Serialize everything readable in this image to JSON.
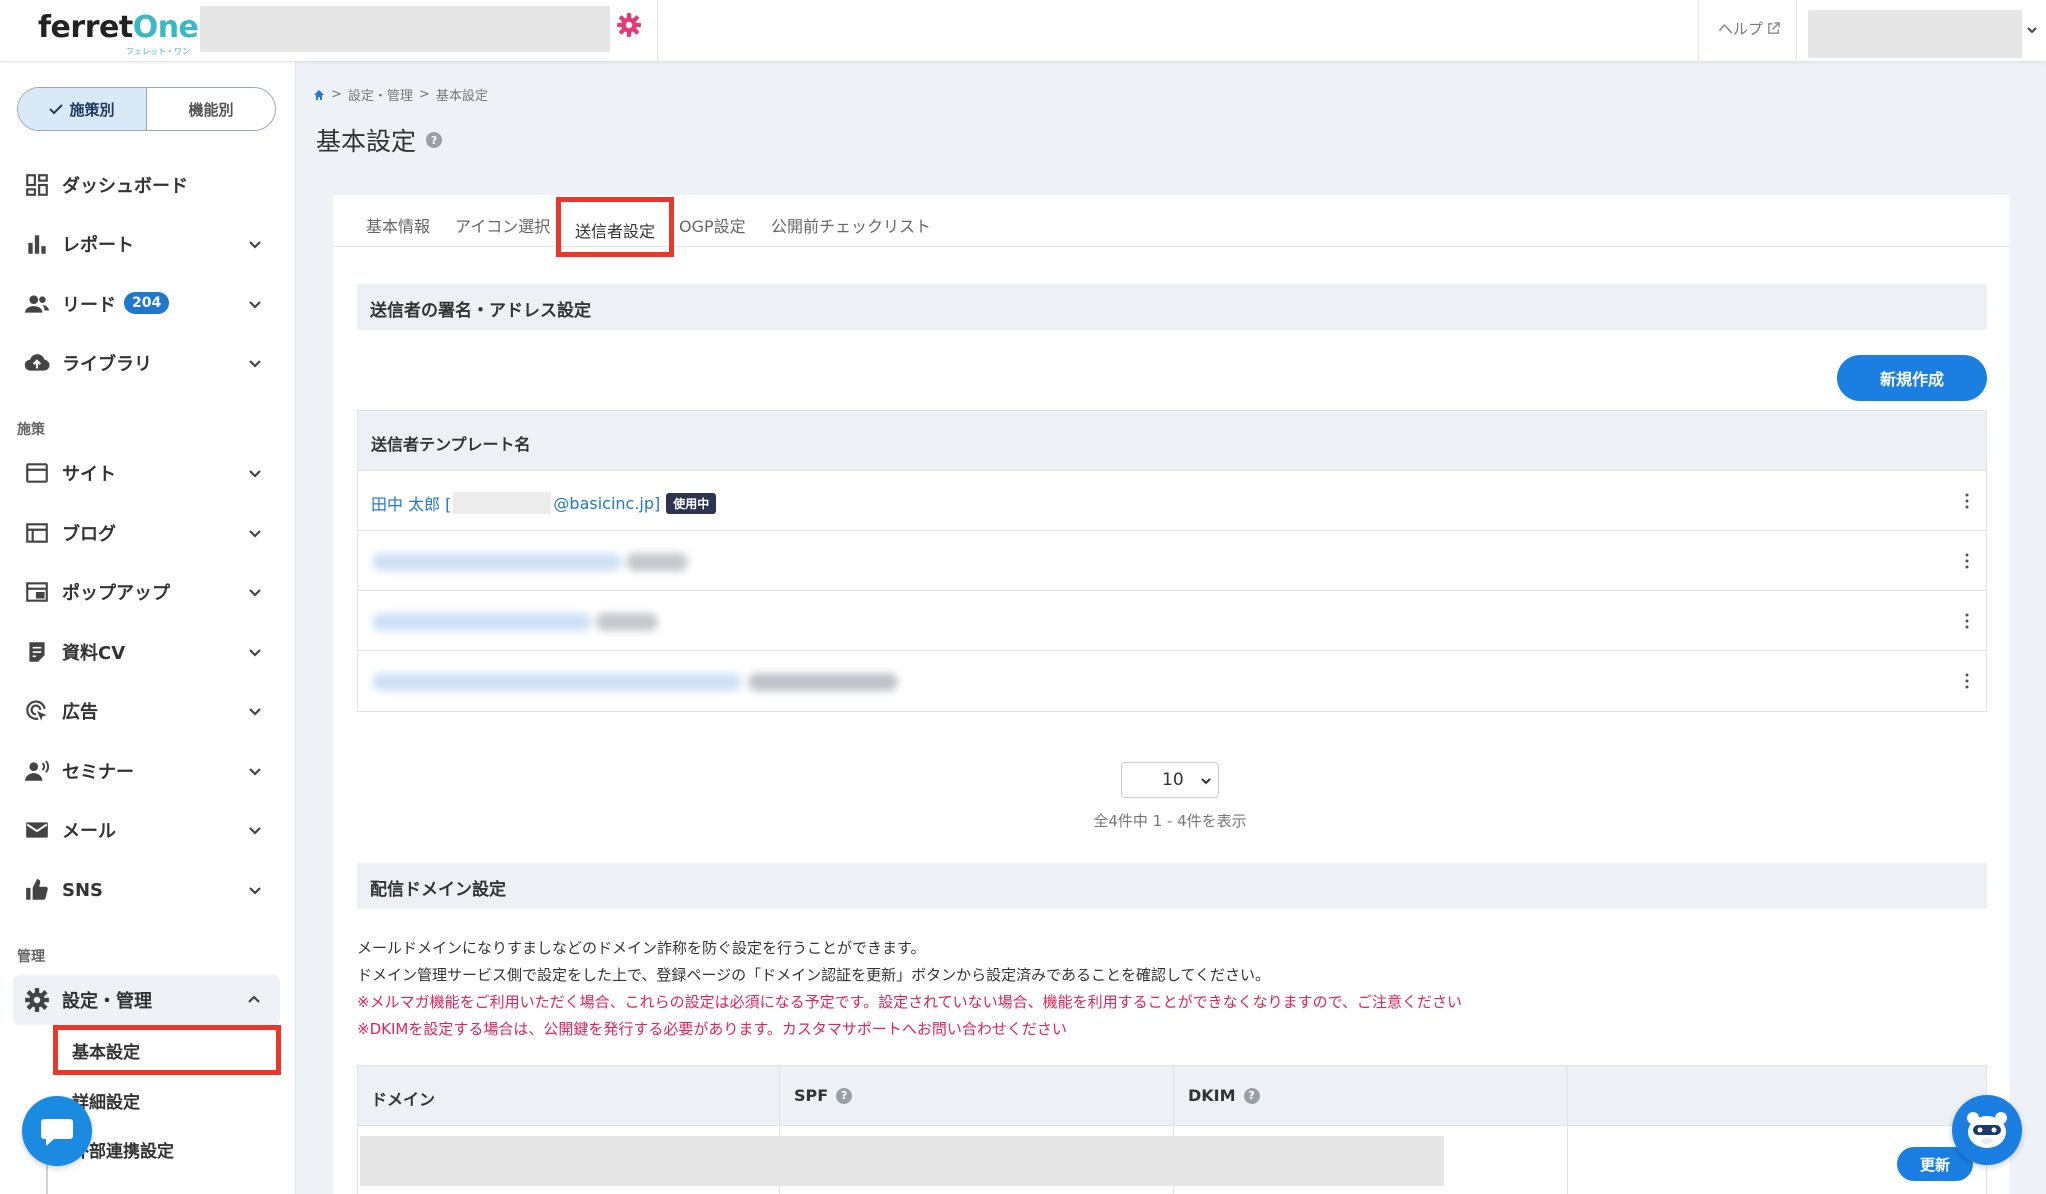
{
  "header": {
    "logo_text_main": "ferret",
    "logo_text_accent": "One",
    "logo_subtext": "フェレット・ワン",
    "help_label": "ヘルプ",
    "site_settings_icon": "gear-icon",
    "help_icon": "external-link-icon"
  },
  "sidebar": {
    "mode_toggle": {
      "active_label": "施策別",
      "inactive_label": "機能別"
    },
    "items": [
      {
        "label": "ダッシュボード",
        "icon": "dashboard-icon"
      },
      {
        "label": "レポート",
        "icon": "bar-chart-icon"
      },
      {
        "label": "リード",
        "icon": "users-icon",
        "badge": "204"
      },
      {
        "label": "ライブラリ",
        "icon": "cloud-upload-icon"
      }
    ],
    "section_measures": "施策",
    "measure_items": [
      {
        "label": "サイト",
        "icon": "browser-icon"
      },
      {
        "label": "ブログ",
        "icon": "blog-icon"
      },
      {
        "label": "ポップアップ",
        "icon": "popup-icon"
      },
      {
        "label": "資料CV",
        "icon": "document-icon"
      },
      {
        "label": "広告",
        "icon": "target-icon"
      },
      {
        "label": "セミナー",
        "icon": "speaker-icon"
      },
      {
        "label": "メール",
        "icon": "mail-icon"
      },
      {
        "label": "SNS",
        "icon": "thumbs-up-icon"
      }
    ],
    "section_admin": "管理",
    "settings_label": "設定・管理",
    "sub_items": [
      "基本設定",
      "詳細設定",
      "外部連携設定"
    ]
  },
  "breadcrumb": {
    "parent": "設定・管理",
    "current": "基本設定"
  },
  "page": {
    "title": "基本設定"
  },
  "tabs": [
    "基本情報",
    "アイコン選択",
    "送信者設定",
    "OGP設定",
    "公開前チェックリスト"
  ],
  "active_tab": "送信者設定",
  "sender_section": {
    "title": "送信者の署名・アドレス設定",
    "new_button": "新規作成",
    "table_header": "送信者テンプレート名",
    "first_row": {
      "name": "田中 太郎 [",
      "address_suffix": "@basicinc.jp]",
      "badge": "使用中"
    },
    "page_size": "10",
    "count_text": "全4件中 1 - 4件を表示"
  },
  "domain_section": {
    "title": "配信ドメイン設定",
    "desc1": "メールドメインになりすましなどのドメイン詐称を防ぐ設定を行うことができます。",
    "desc2": "ドメイン管理サービス側で設定をした上で、登録ページの「ドメイン認証を更新」ボタンから設定済みであることを確認してください。",
    "warn1": "※メルマガ機能をご利用いただく場合、これらの設定は必須になる予定です。設定されていない場合、機能を利用することができなくなりますので、ご注意ください",
    "warn2": "※DKIMを設定する場合は、公開鍵を発行する必要があります。カスタマサポートへお問い合わせください",
    "col_domain": "ドメイン",
    "col_spf": "SPF",
    "col_dkim": "DKIM",
    "refresh_button": "更新"
  },
  "colors": {
    "primary": "#1a7fe0",
    "highlight": "#e9372b",
    "warning_text": "#e0235b",
    "accent": "#3ab8c4",
    "gear": "#e6397a"
  }
}
